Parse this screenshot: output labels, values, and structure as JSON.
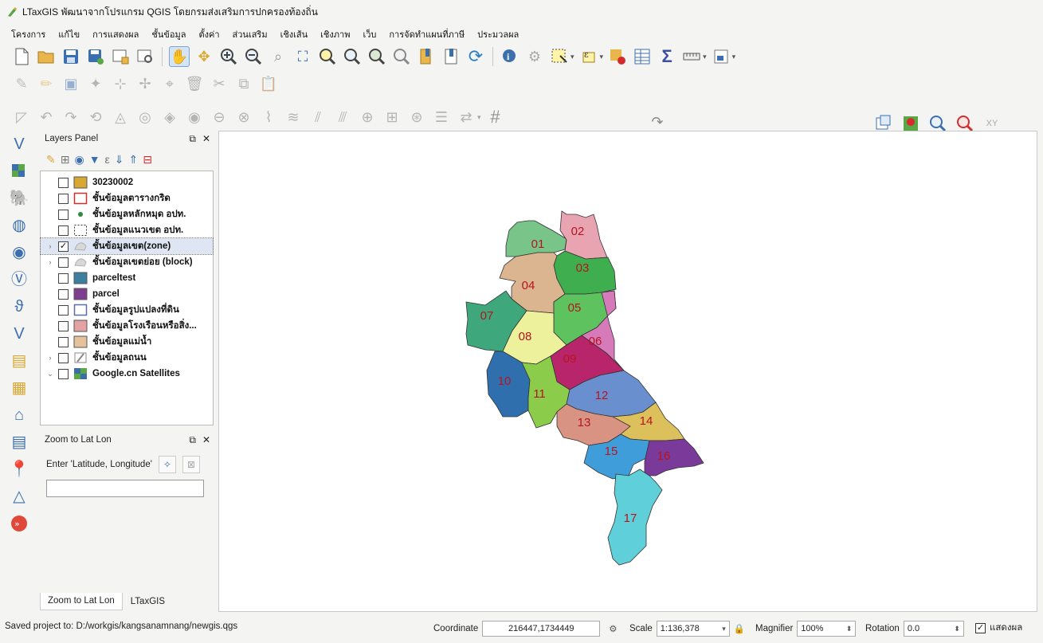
{
  "window": {
    "title": "LTaxGIS พัฒนาจากโปรแกรม QGIS โดยกรมส่งเสริมการปกครองท้องถิ่น"
  },
  "menu": [
    "โครงการ",
    "แก้ไข",
    "การแสดงผล",
    "ชั้นข้อมูล",
    "ตั้งค่า",
    "ส่วนเสริม",
    "เชิงเส้น",
    "เชิงภาพ",
    "เว็บ",
    "การจัดทำแผนที่ภาษี",
    "ประมวลผล"
  ],
  "layers_panel": {
    "title": "Layers Panel",
    "layers": [
      {
        "name": "30230002",
        "checked": false,
        "expander": "",
        "symbol": "fill",
        "color": "#d9a832",
        "selected": false
      },
      {
        "name": "ชั้นข้อมูลตารางกริด",
        "checked": false,
        "expander": "",
        "symbol": "outline",
        "color": "#d42c2c",
        "selected": false
      },
      {
        "name": "ชั้นข้อมูลหลักหมุด อปท.",
        "checked": false,
        "expander": "",
        "symbol": "point",
        "color": "#2e8b3a",
        "selected": false
      },
      {
        "name": "ชั้นข้อมูลแนวเขต อปท.",
        "checked": false,
        "expander": "",
        "symbol": "dashed",
        "color": "#333333",
        "selected": false
      },
      {
        "name": "ชั้นข้อมูลเขต(zone)",
        "checked": true,
        "expander": "›",
        "symbol": "style",
        "color": "#b0b0b0",
        "selected": true
      },
      {
        "name": "ชั้นข้อมูลเขตย่อย (block)",
        "checked": false,
        "expander": "›",
        "symbol": "style",
        "color": "#b0b0b0",
        "selected": false
      },
      {
        "name": "parceltest",
        "checked": false,
        "expander": "",
        "symbol": "fill",
        "color": "#3c7f9e",
        "selected": false
      },
      {
        "name": "parcel",
        "checked": false,
        "expander": "",
        "symbol": "fill",
        "color": "#7e3d8f",
        "selected": false
      },
      {
        "name": "ชั้นข้อมูลรูปแปลงที่ดิน",
        "checked": false,
        "expander": "",
        "symbol": "outline",
        "color": "#5a6fa8",
        "selected": false
      },
      {
        "name": "ชั้นข้อมูลโรงเรือนหรือสิ่ง...",
        "checked": false,
        "expander": "",
        "symbol": "fill",
        "color": "#e3a3a3",
        "selected": false
      },
      {
        "name": "ชั้นข้อมูลแม่น้ำ",
        "checked": false,
        "expander": "",
        "symbol": "fill",
        "color": "#e5c29c",
        "selected": false
      },
      {
        "name": "ชั้นข้อมูลถนน",
        "checked": false,
        "expander": "›",
        "symbol": "road",
        "color": "#888888",
        "selected": false
      },
      {
        "name": "Google.cn Satellites",
        "checked": false,
        "expander": "⌄",
        "symbol": "raster",
        "color": "#3a6ea5",
        "selected": false
      }
    ]
  },
  "zoom_panel": {
    "title": "Zoom to Lat Lon",
    "prompt": "Enter 'Latitude, Longitude'",
    "value": ""
  },
  "tabs": [
    "Zoom to Lat Lon",
    "LTaxGIS"
  ],
  "map": {
    "zones": [
      {
        "id": "01",
        "color": "#79c489"
      },
      {
        "id": "02",
        "color": "#e8a4b0"
      },
      {
        "id": "03",
        "color": "#3fae4f"
      },
      {
        "id": "04",
        "color": "#dbb490"
      },
      {
        "id": "05",
        "color": "#5ec25e"
      },
      {
        "id": "06",
        "color": "#d77ab9"
      },
      {
        "id": "07",
        "color": "#3fa77c"
      },
      {
        "id": "08",
        "color": "#eef19c"
      },
      {
        "id": "09",
        "color": "#b8256a"
      },
      {
        "id": "10",
        "color": "#2f6fae"
      },
      {
        "id": "11",
        "color": "#8bcc4a"
      },
      {
        "id": "12",
        "color": "#6a8fcf"
      },
      {
        "id": "13",
        "color": "#d99383"
      },
      {
        "id": "14",
        "color": "#dcc05c"
      },
      {
        "id": "15",
        "color": "#3f9ed9"
      },
      {
        "id": "16",
        "color": "#7a3a9a"
      },
      {
        "id": "17",
        "color": "#5fcfd9"
      }
    ]
  },
  "status": {
    "message": "Saved project to: D:/workgis/kangsanamnang/newgis.qgs",
    "coordinate_label": "Coordinate",
    "coordinate": "216447,1734449",
    "scale_label": "Scale",
    "scale": "1:136,378",
    "magnifier_label": "Magnifier",
    "magnifier": "100%",
    "rotation_label": "Rotation",
    "rotation": "0.0",
    "render_label": "แสดงผล",
    "render_checked": true
  }
}
